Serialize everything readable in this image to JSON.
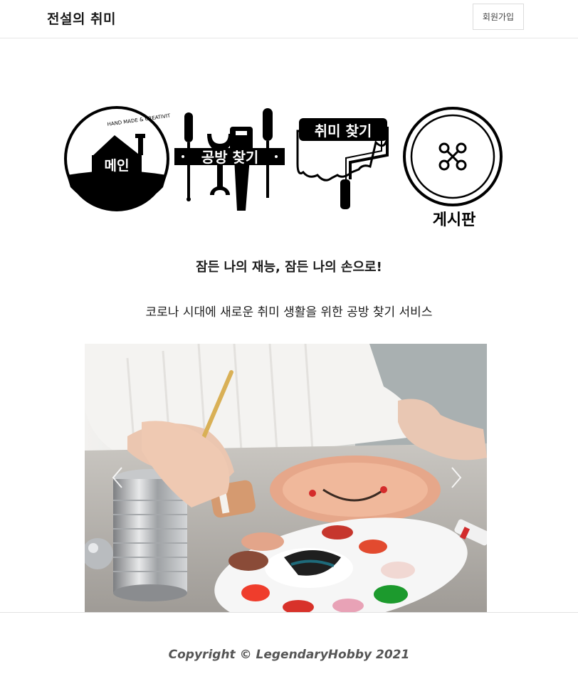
{
  "header": {
    "brand": "전설의 취미",
    "signup_label": "회원가입"
  },
  "nav": {
    "main": {
      "label": "메인",
      "badge_text": "HAND MADE & CREATIVITY",
      "icon": "house-stamp-icon"
    },
    "workshop": {
      "label": "공방 찾기",
      "icon": "tools-icon"
    },
    "hobby": {
      "label": "취미 찾기",
      "icon": "paint-roller-icon"
    },
    "board": {
      "label": "게시판",
      "icon": "button-icon"
    }
  },
  "hero": {
    "tagline": "잠든 나의 재능, 잠든 나의 손으로!",
    "subtitle": "코로나 시대에 새로운 취미 생활을 위한 공방 찾기 서비스"
  },
  "carousel": {
    "image": "child-painting-photo",
    "prev_icon": "chevron-left-icon",
    "next_icon": "chevron-right-icon"
  },
  "footer": {
    "copyright": "Copyright © LegendaryHobby 2021"
  }
}
